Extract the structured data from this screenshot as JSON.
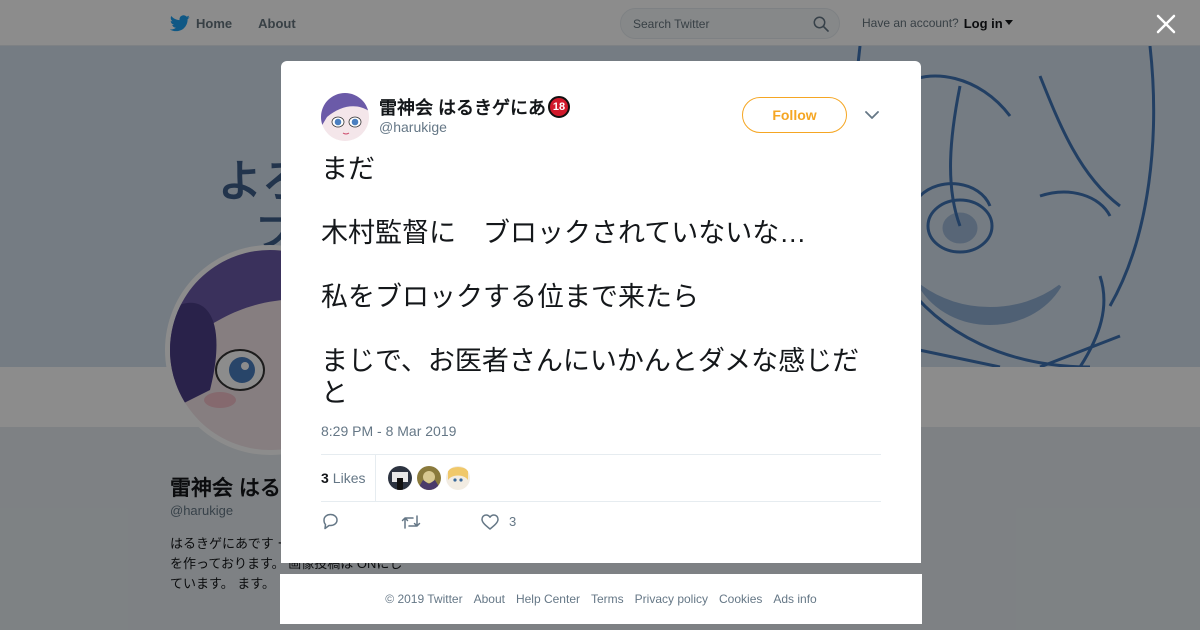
{
  "nav": {
    "home_label": "Home",
    "about_label": "About",
    "search_placeholder": "Search Twitter",
    "have_account": "Have an account?",
    "login_label": "Log in"
  },
  "profile": {
    "banner_text_1": "よろ",
    "banner_text_2": "フ",
    "name": "雷神会 はる",
    "handle": "@harukige",
    "bio": "はるきゲにあです ークルで、エッチな本を作っております。 画像投稿は ONにしています。 ます。"
  },
  "tweet": {
    "author_name": "雷神会 はるきゲにあ",
    "author_badge": "18",
    "author_handle": "@harukige",
    "follow_label": "Follow",
    "lines": [
      "まだ",
      "木村監督に　ブロックされていないな…",
      "私をブロックする位まで来たら",
      "まじで、お医者さんにいかんとダメな感じだと"
    ],
    "timestamp": "8:29 PM - 8 Mar 2019",
    "likes_count": "3",
    "likes_label": "Likes",
    "action_like_count": "3"
  },
  "footer": {
    "links": [
      "© 2019 Twitter",
      "About",
      "Help Center",
      "Terms",
      "Privacy policy",
      "Cookies",
      "Ads info"
    ]
  },
  "icons": {
    "brand": "twitter-bird-icon",
    "home": "home-icon",
    "search": "search-icon",
    "close": "close-icon",
    "reply": "reply-icon",
    "retweet": "retweet-icon",
    "like": "heart-icon"
  },
  "colors": {
    "brand_blue": "#1da1f2",
    "follow_orange": "#f5a623",
    "badge_red": "#d1192b",
    "banner_tint": "#3f73b5"
  }
}
